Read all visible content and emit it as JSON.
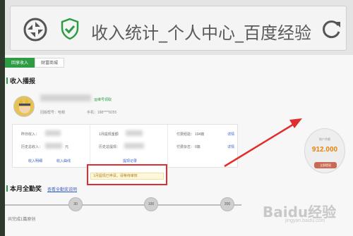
{
  "browser": {
    "title": "收入统计_个人中心_百度经验"
  },
  "tabs": [
    {
      "label": "回享收入"
    },
    {
      "label": "财富商城"
    }
  ],
  "income": {
    "section_title": "收入播报",
    "verify_link": "运维号领取",
    "user_line_1": "回版帮号：哈帽",
    "phone": "手机：188****8255"
  },
  "stats": {
    "row1": [
      {
        "label": "昨日收入：",
        "value": ""
      },
      {
        "label": "1月提现金额",
        "value": ""
      },
      {
        "label": "付费经验：",
        "value": "194篇",
        "link": "详情"
      }
    ],
    "row2": [
      {
        "label": "历史总收入：",
        "value": "元"
      },
      {
        "label": "历史总提现：",
        "value": ""
      },
      {
        "label": "付费杂志：",
        "value": "0篇",
        "link": "详情"
      }
    ],
    "footer_links": [
      "收入明细",
      "收入曲线",
      "提现记录"
    ]
  },
  "notice": {
    "text": "1月提现已申请，请等待审核"
  },
  "balance": {
    "label": "账户余额",
    "amount": "912.000",
    "withdraw_button": "立即提现"
  },
  "attendance": {
    "title": "本月全勤奖",
    "rules_link": "查看全勤奖说明",
    "summary": "共完成1篇原创",
    "milestones": [
      "30",
      "100",
      "200"
    ]
  },
  "watermark": {
    "main": "Baidu经验",
    "sub": "jingyan.baidu.com"
  },
  "colors": {
    "accent_green": "#2d9c45",
    "highlight_red": "#e02d2d",
    "amount_orange": "#e8820e"
  }
}
